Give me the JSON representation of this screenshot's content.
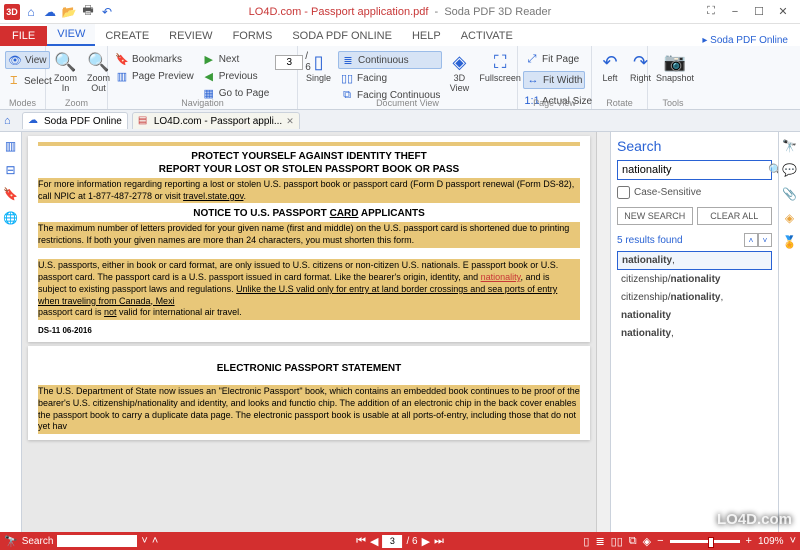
{
  "app": {
    "name": "Soda PDF 3D Reader",
    "online_link": "Soda PDF Online",
    "document_filename": "LO4D.com - Passport application.pdf"
  },
  "qat": {
    "logo": "3D",
    "home_icon": "home-icon",
    "cloud_icon": "cloud-icon",
    "open_icon": "open-icon",
    "print_icon": "print-icon",
    "undo_icon": "undo-icon"
  },
  "window_controls": {
    "fullscreen": "fullscreen-icon",
    "minimize": "−",
    "maximize": "☐",
    "close": "✕"
  },
  "tabs": {
    "file": "FILE",
    "items": [
      "VIEW",
      "CREATE",
      "REVIEW",
      "FORMS",
      "SODA PDF ONLINE",
      "HELP",
      "ACTIVATE"
    ],
    "active_index": 0
  },
  "ribbon": {
    "modes": {
      "label": "Modes",
      "view": "View",
      "select": "Select"
    },
    "zoom": {
      "label": "Zoom",
      "in": "Zoom In",
      "out": "Zoom Out"
    },
    "navigation": {
      "label": "Navigation",
      "bookmarks": "Bookmarks",
      "page_preview": "Page Preview",
      "next": "Next",
      "previous": "Previous",
      "go_to_page": "Go to Page",
      "page_current": "3",
      "page_total": "/   6"
    },
    "docview": {
      "label": "Document View",
      "single": "Single",
      "continuous": "Continuous",
      "facing": "Facing",
      "facing_continuous": "Facing Continuous",
      "threed": "3D View",
      "fullscreen": "Fullscreen"
    },
    "pageview": {
      "label": "Page View",
      "fit_page": "Fit Page",
      "fit_width": "Fit Width",
      "actual_size": "Actual Size"
    },
    "rotate": {
      "label": "Rotate",
      "left": "Left",
      "right": "Right"
    },
    "tools": {
      "label": "Tools",
      "snapshot": "Snapshot"
    }
  },
  "doctabs": [
    {
      "label": "Soda PDF Online",
      "icon": "cloud-icon",
      "active": false
    },
    {
      "label": "LO4D.com - Passport appli...",
      "icon": "pdf-icon",
      "active": true
    }
  ],
  "document": {
    "h1a": "PROTECT YOURSELF AGAINST IDENTITY THEFT",
    "h1b": "REPORT YOUR LOST OR STOLEN PASSPORT BOOK OR PASS",
    "p1": "For more information regarding reporting a lost or stolen U.S. passport book or passport card (Form D\npassport renewal (Form DS-82), call NPIC at 1-877-487-2778 or visit ",
    "p1_link": "travel.state.gov",
    "h2": "NOTICE TO U.S. PASSPORT ",
    "h2_u": "CARD",
    "h2_b": " APPLICANTS",
    "p2": "The maximum number of letters provided for your given name (first and middle) on the U.S. passport card is\nshortened due to printing restrictions. If both your given names are more than 24 characters, you must shorten\nthis form.",
    "p3a": "U.S. passports, either in book or card format, are only issued to U.S. citizens or non-citizen U.S. nationals. E\npassport book or U.S. passport card. The passport card is a U.S. passport issued in card format. Like the\nbearer's origin, identity, and ",
    "p3_hit": "nationality",
    "p3b": ", and is subject to existing passport laws and regulations. ",
    "p3_u": "Unlike the U.S\nvalid only for entry at land border crossings and sea ports of entry when traveling from Canada, Mexi",
    "p3c": "passport card is ",
    "p3_not": "not",
    "p3d": " valid for international air travel.",
    "footer": "DS-11   06-2016",
    "h3": "ELECTRONIC PASSPORT STATEMENT",
    "p4": "The U.S. Department of State now issues an \"Electronic Passport\" book, which contains an embedded\nbook continues to be proof of the bearer's U.S. citizenship/nationality and identity, and looks and functio\nchip. The addition of an electronic chip in the back cover enables the passport book to carry a duplicate\ndata page. The electronic passport book is usable at all ports-of-entry, including those that do not yet hav"
  },
  "search": {
    "title": "Search",
    "query": "nationality",
    "case_sensitive_label": "Case-Sensitive",
    "new_search": "NEW SEARCH",
    "clear_all": "CLEAR ALL",
    "results_count": "5 results found",
    "results": [
      {
        "prefix": "",
        "match": "nationality",
        "suffix": ",",
        "selected": true
      },
      {
        "prefix": "citizenship/",
        "match": "nationality",
        "suffix": "",
        "selected": false
      },
      {
        "prefix": "citizenship/",
        "match": "nationality",
        "suffix": ",",
        "selected": false
      },
      {
        "prefix": "",
        "match": "nationality",
        "suffix": "",
        "selected": false
      },
      {
        "prefix": "",
        "match": "nationality",
        "suffix": ",",
        "selected": false
      }
    ]
  },
  "statusbar": {
    "search_label": "Search",
    "page_current": "3",
    "page_total": "/  6",
    "zoom": "109%"
  },
  "watermark": "LO4D.com"
}
